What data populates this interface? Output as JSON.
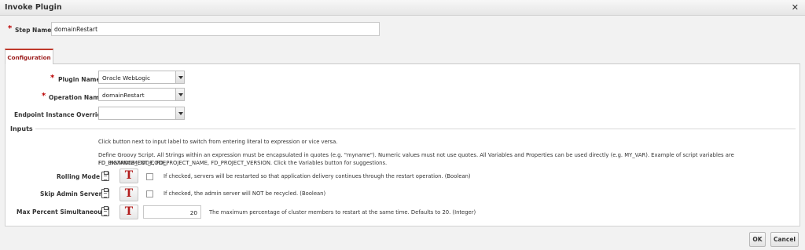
{
  "dialog": {
    "title": "Invoke Plugin",
    "close_glyph": "✕"
  },
  "step_name": {
    "label": "Step Name",
    "value": "domainRestart"
  },
  "tabs": [
    {
      "label": "Configuration",
      "active": true
    }
  ],
  "config": {
    "plugin_name": {
      "label": "Plugin Name",
      "value": "Oracle WebLogic"
    },
    "operation_name": {
      "label": "Operation Name",
      "value": "domainRestart"
    },
    "endpoint_override": {
      "label": "Endpoint Instance Override",
      "value": ""
    }
  },
  "inputs": {
    "section_label": "Inputs",
    "help1": "Click button next to input label to switch from entering literal to expression or vice versa.",
    "help2a": "Define Groovy Script. All Strings within an expression must be encapsulated in quotes (e.g. \"myname\"). Numeric values must not use quotes. All Variables and Properties can be used directly (e.g. MY_VAR). Example of script variables are FD_ENVIRONMENT_CODE,",
    "help2b": "FD_INSTANCE_CODE, FD_PROJECT_NAME, FD_PROJECT_VERSION. Click the Variables button for suggestions.",
    "rows": [
      {
        "label": "Rolling Mode",
        "toggle_glyph": "T",
        "checked": false,
        "description": "If checked, servers will be restarted so that application delivery continues through the restart operation. (Boolean)"
      },
      {
        "label": "Skip Admin Server",
        "toggle_glyph": "T",
        "checked": false,
        "description": "If checked, the admin server will NOT be recycled. (Boolean)"
      },
      {
        "label": "Max Percent Simultaneous",
        "toggle_glyph": "T",
        "value": "20",
        "description": "The maximum percentage of cluster members to restart at the same time. Defaults to 20. (Integer)"
      }
    ]
  },
  "footer": {
    "ok_label": "OK",
    "cancel_label": "Cancel"
  },
  "colors": {
    "accent": "#c0392b",
    "required": "#b00000"
  }
}
